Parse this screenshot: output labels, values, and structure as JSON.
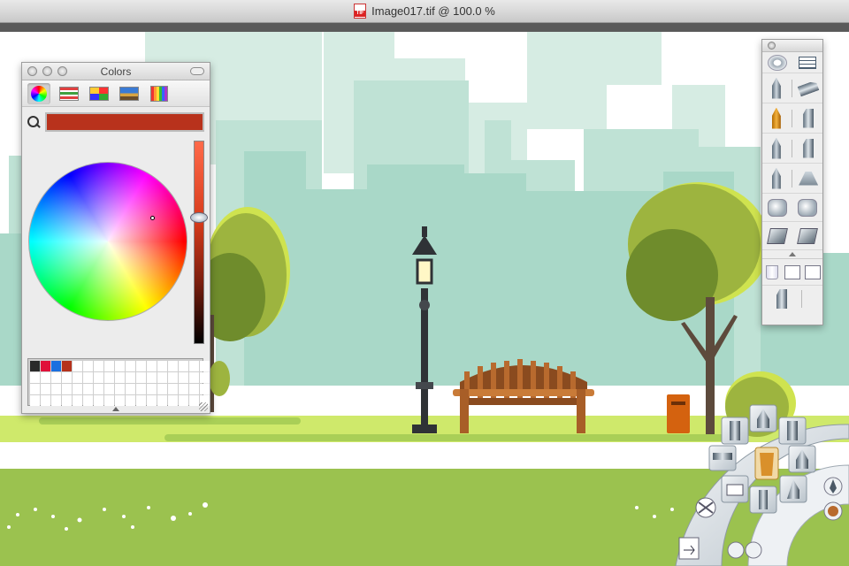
{
  "window": {
    "title": "Image017.tif @ 100.0 %",
    "file_badge": "TIF"
  },
  "colors_panel": {
    "title": "Colors",
    "modes": [
      {
        "name": "color-wheel",
        "active": true
      },
      {
        "name": "color-sliders",
        "active": false
      },
      {
        "name": "color-palettes",
        "active": false
      },
      {
        "name": "image-palettes",
        "active": false
      },
      {
        "name": "crayons",
        "active": false
      }
    ],
    "current_color": "#b8321c",
    "swatches": [
      "#2a2a2a",
      "#e0103a",
      "#1a6fe0",
      "#b5321c"
    ],
    "brightness_level": 0.38
  },
  "toolbox": {
    "tool_icons": [
      "restore-icon",
      "brush-settings-icon",
      "pencil-icon",
      "airbrush-icon",
      "marker-icon",
      "flat-brush-icon",
      "pen-icon",
      "chisel-brush-icon",
      "fine-brush-icon",
      "blender-icon",
      "stamp-fill-icon",
      "stamp-erase-icon",
      "smudge-icon",
      "fill-icon",
      "trash-icon",
      "sparkle-icon",
      "text-icon",
      "eraser-icon"
    ]
  },
  "radial_menu": {
    "tools": [
      "marker-icon",
      "pen-icon",
      "flat-brush-icon",
      "airbrush-icon",
      "chisel-brush-icon",
      "paint-bucket-icon",
      "stamp-icon",
      "fine-brush-icon",
      "scissors-icon",
      "color-swatch-icon"
    ]
  },
  "scene": {
    "colors": {
      "sky": "#ffffff",
      "city_light": "#d6ece3",
      "city_mid": "#b6ded0",
      "city_dark": "#a5d5c5",
      "path": "#ffffff",
      "grass_light": "#cfe96b",
      "grass": "#9bc24f",
      "tree_light": "#9db43f",
      "tree_dark": "#6f8c2c",
      "trunk": "#5d4a3c",
      "bench": "#b86a2e",
      "lamp": "#2f3236",
      "bin": "#d4620f"
    }
  }
}
